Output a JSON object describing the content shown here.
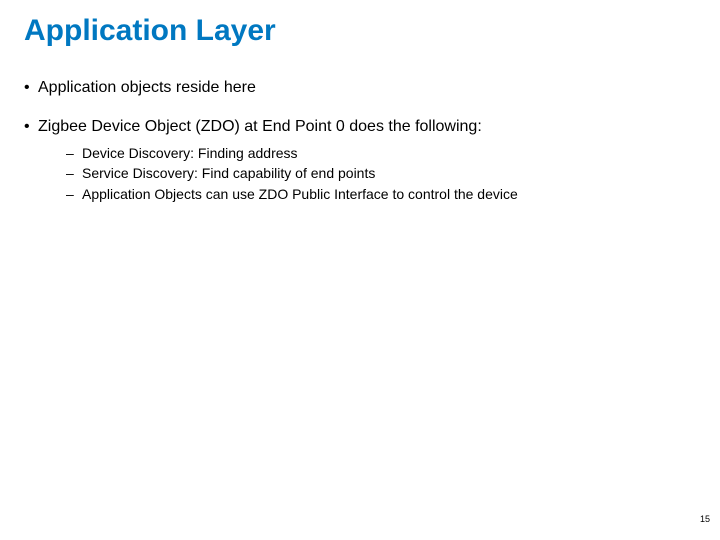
{
  "title": "Application Layer",
  "bullets": [
    "Application objects reside here",
    "Zigbee Device Object (ZDO) at End Point 0 does the following:"
  ],
  "sub_bullets": [
    "Device Discovery: Finding address",
    "Service Discovery: Find capability of end points",
    "Application Objects can use ZDO Public Interface to control the device"
  ],
  "page_number": "15"
}
